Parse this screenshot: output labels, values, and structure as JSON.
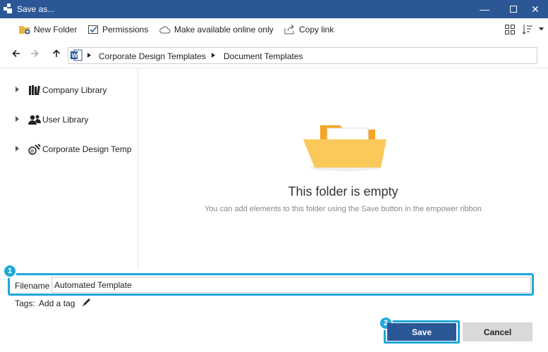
{
  "window": {
    "title": "Save as...",
    "accent": "#2b5797",
    "controls": [
      "minimize-icon",
      "maximize-icon",
      "close-icon"
    ]
  },
  "toolbar": {
    "new_folder": "New Folder",
    "permissions": "Permissions",
    "offline": "Make available online only",
    "copy_link": "Copy link"
  },
  "breadcrumb": {
    "items": [
      "Corporate Design Templates",
      "Document Templates"
    ]
  },
  "sidebar": {
    "items": [
      {
        "label": "Company Library",
        "icon": "books-icon"
      },
      {
        "label": "User Library",
        "icon": "users-icon"
      },
      {
        "label": "Corporate Design Temp",
        "icon": "tools-icon"
      }
    ]
  },
  "main": {
    "empty_title": "This folder is empty",
    "empty_subtitle": "You can add elements to this folder using the Save button in the empower ribbon"
  },
  "form": {
    "filename_label": "Filename",
    "filename_value": "Automated Template",
    "tags_label": "Tags:",
    "add_tag": "Add a tag"
  },
  "callouts": [
    "1",
    "2"
  ],
  "buttons": {
    "save": "Save",
    "cancel": "Cancel"
  },
  "highlight_color": "#1fa8d8"
}
